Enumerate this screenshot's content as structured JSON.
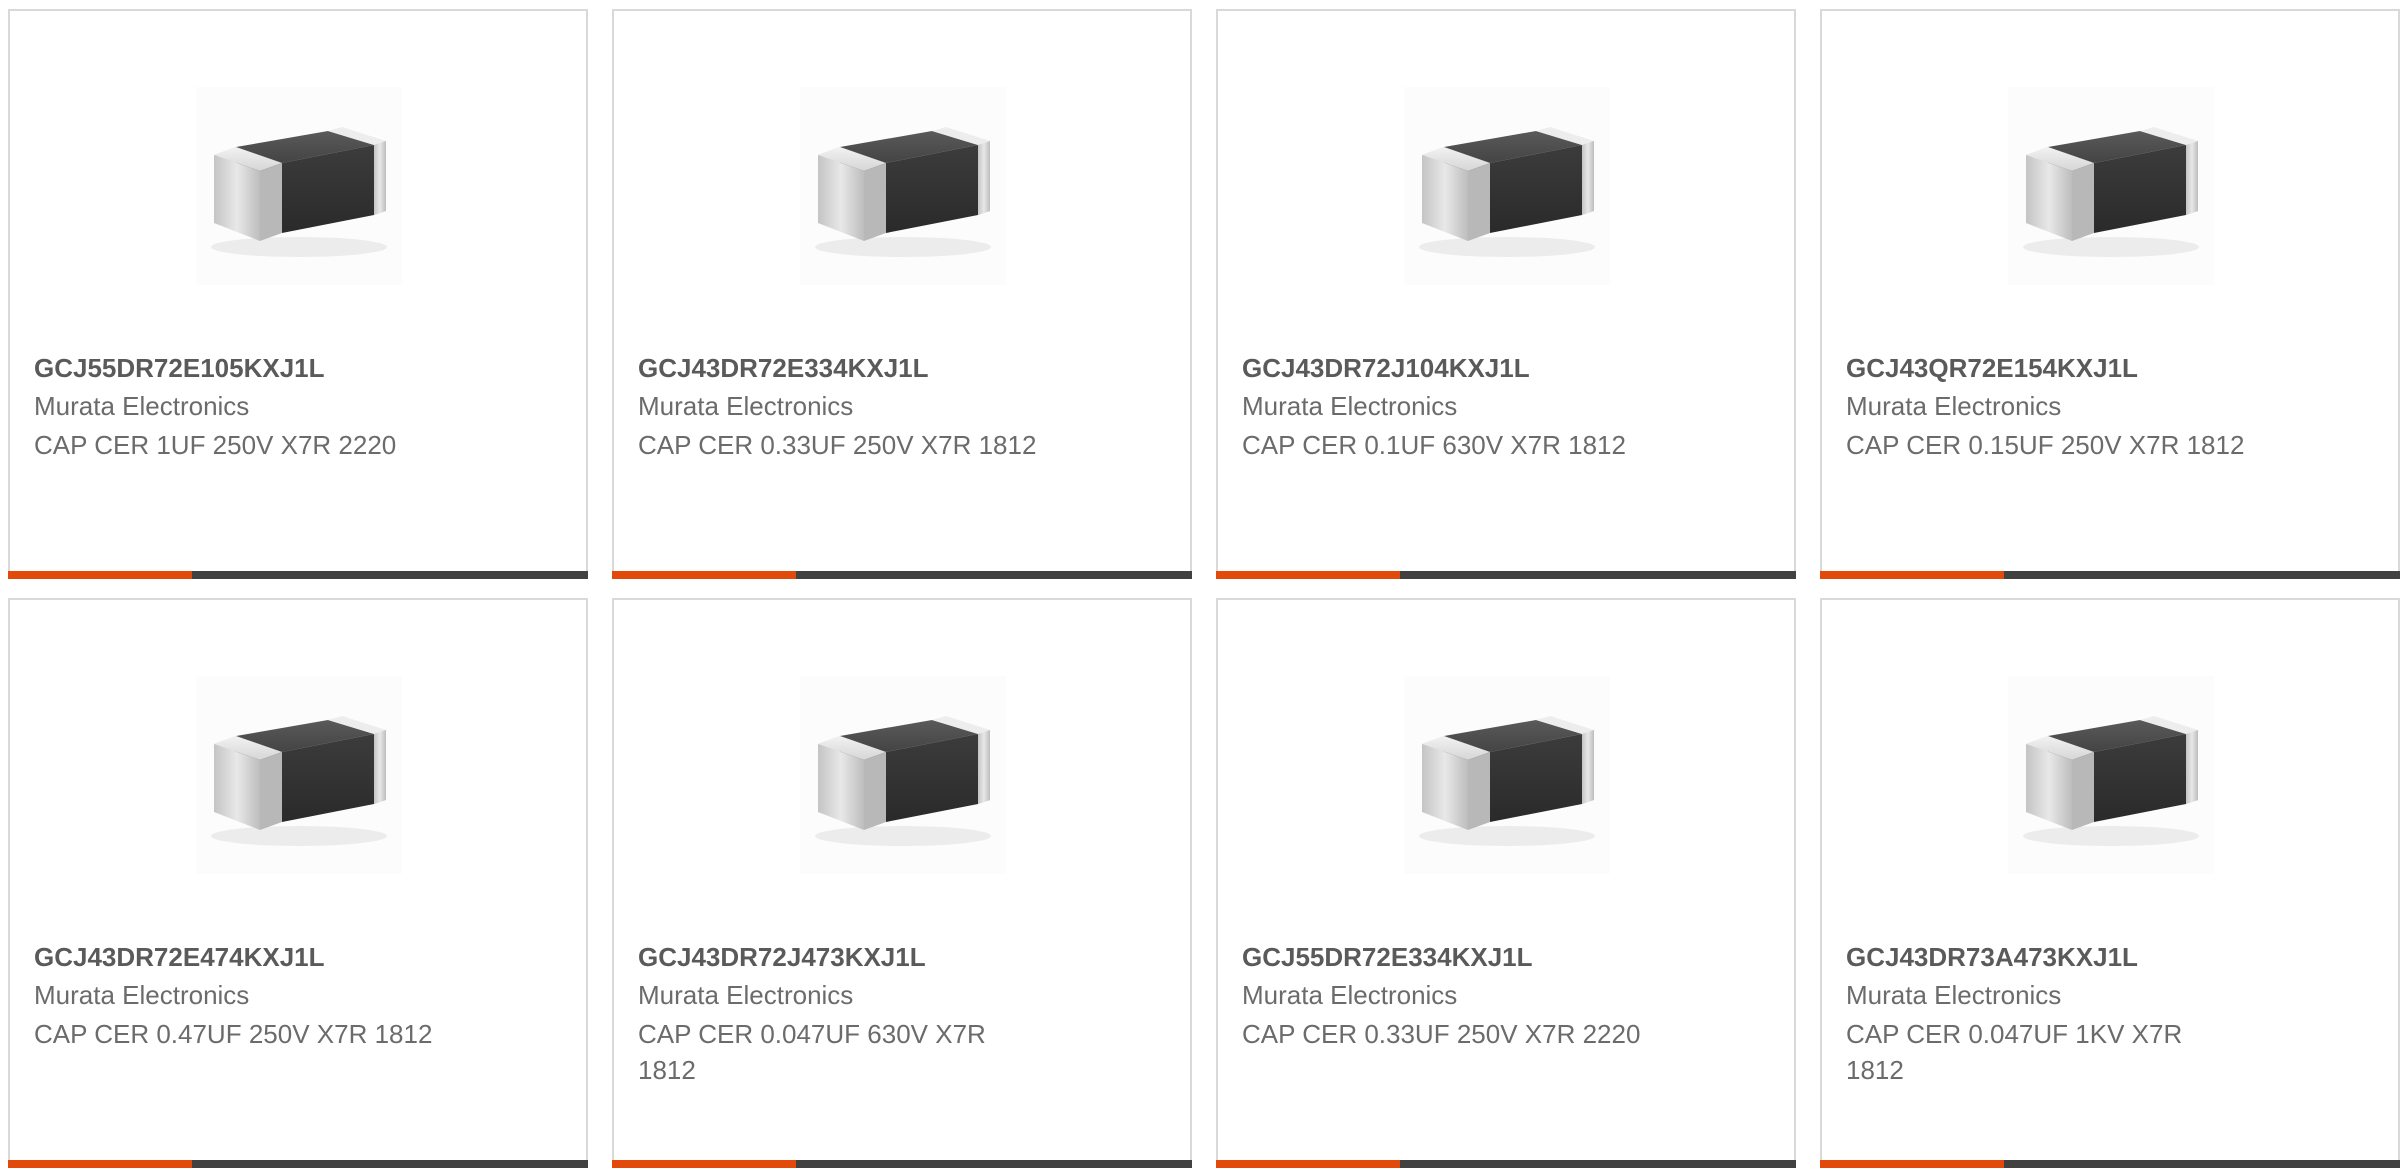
{
  "colors": {
    "accent": "#e24a0c",
    "bar_dark": "#414141",
    "card_border": "#d9d9d9",
    "title_text": "#5a5a5a",
    "body_text": "#6b6b6b"
  },
  "products": [
    {
      "part_number": "GCJ55DR72E105KXJ1L",
      "manufacturer": "Murata Electronics",
      "description": "CAP CER 1UF 250V X7R 2220",
      "image_icon": "smd-capacitor-chip-icon"
    },
    {
      "part_number": "GCJ43DR72E334KXJ1L",
      "manufacturer": "Murata Electronics",
      "description": "CAP CER 0.33UF 250V X7R 1812",
      "image_icon": "smd-capacitor-chip-icon"
    },
    {
      "part_number": "GCJ43DR72J104KXJ1L",
      "manufacturer": "Murata Electronics",
      "description": "CAP CER 0.1UF 630V X7R 1812",
      "image_icon": "smd-capacitor-chip-icon"
    },
    {
      "part_number": "GCJ43QR72E154KXJ1L",
      "manufacturer": "Murata Electronics",
      "description": "CAP CER 0.15UF 250V X7R 1812",
      "image_icon": "smd-capacitor-chip-icon"
    },
    {
      "part_number": "GCJ43DR72E474KXJ1L",
      "manufacturer": "Murata Electronics",
      "description": "CAP CER 0.47UF 250V X7R 1812",
      "image_icon": "smd-capacitor-chip-icon"
    },
    {
      "part_number": "GCJ43DR72J473KXJ1L",
      "manufacturer": "Murata Electronics",
      "description": "CAP CER 0.047UF 630V X7R 1812",
      "image_icon": "smd-capacitor-chip-icon"
    },
    {
      "part_number": "GCJ55DR72E334KXJ1L",
      "manufacturer": "Murata Electronics",
      "description": "CAP CER 0.33UF 250V X7R 2220",
      "image_icon": "smd-capacitor-chip-icon"
    },
    {
      "part_number": "GCJ43DR73A473KXJ1L",
      "manufacturer": "Murata Electronics",
      "description": "CAP CER 0.047UF 1KV X7R 1812",
      "image_icon": "smd-capacitor-chip-icon"
    }
  ]
}
